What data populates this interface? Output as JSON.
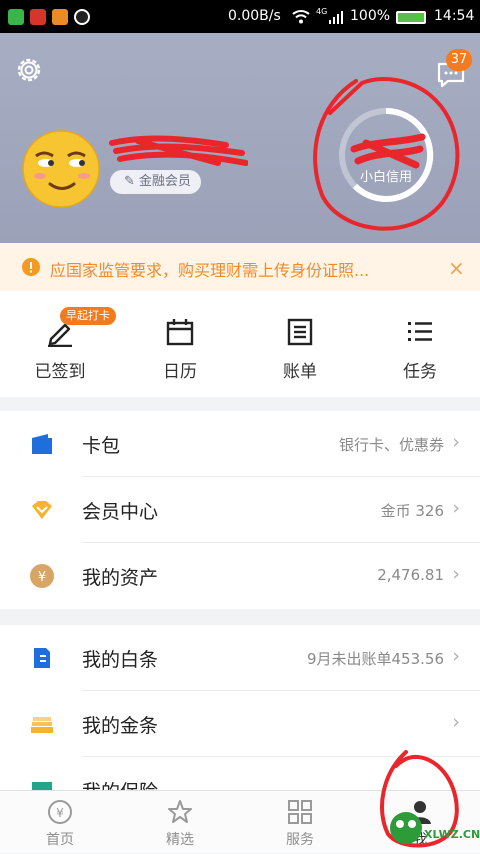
{
  "status_bar": {
    "net_speed": "0.00B/s",
    "network": "4G",
    "battery": "100%",
    "time": "14:54"
  },
  "header": {
    "settings_icon": "gear-icon",
    "messages_icon": "message-icon",
    "message_count": "37",
    "member_badge": "金融会员",
    "credit_label": "小白信用"
  },
  "notice": {
    "text": "应国家监管要求，购买理财需上传身份证照...",
    "close": "×"
  },
  "quick_actions": [
    {
      "label": "已签到",
      "icon": "pen-icon",
      "badge": "早起打卡"
    },
    {
      "label": "日历",
      "icon": "calendar-icon"
    },
    {
      "label": "账单",
      "icon": "bill-icon"
    },
    {
      "label": "任务",
      "icon": "list-icon"
    }
  ],
  "section1": [
    {
      "label": "卡包",
      "value": "银行卡、优惠券",
      "icon": "card-wallet-icon",
      "color": "#1e6fdc"
    },
    {
      "label": "会员中心",
      "value": "金币 326",
      "icon": "diamond-icon",
      "color": "#f6b32b"
    },
    {
      "label": "我的资产",
      "value": "2,476.81",
      "icon": "yuan-coin-icon",
      "color": "#d9a566"
    }
  ],
  "section2": [
    {
      "label": "我的白条",
      "value": "9月未出账单453.56",
      "icon": "white-bar-icon",
      "color": "#1e6fdc"
    },
    {
      "label": "我的金条",
      "value": "",
      "icon": "gold-bar-icon",
      "color": "#f6b32b"
    },
    {
      "label": "我的保险",
      "value": "",
      "icon": "insurance-icon",
      "color": "#20a68a"
    }
  ],
  "tabs": [
    {
      "label": "首页",
      "icon": "home-yuan-icon"
    },
    {
      "label": "精选",
      "icon": "star-icon"
    },
    {
      "label": "服务",
      "icon": "grid-icon"
    },
    {
      "label": "我",
      "icon": "person-icon"
    }
  ],
  "watermark": "XLWZ.CN",
  "colors": {
    "accent_orange": "#f37b1d",
    "brand_blue": "#1e6fdc",
    "annotation_red": "#e8262c"
  }
}
